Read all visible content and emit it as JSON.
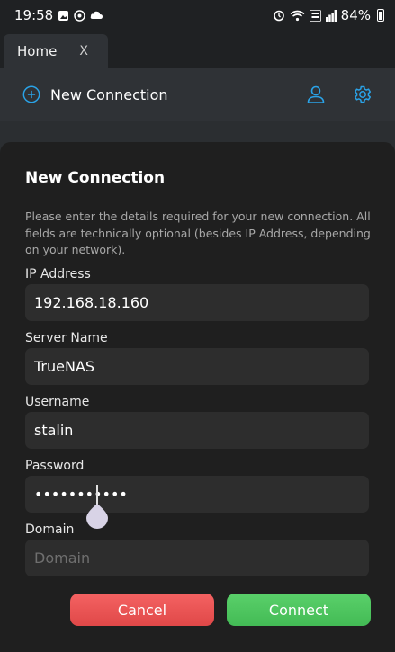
{
  "status_bar": {
    "time": "19:58",
    "battery": "84%"
  },
  "tab": {
    "label": "Home",
    "close": "X"
  },
  "toolbar": {
    "new_connection_label": "New Connection",
    "accent": "#2aa3e8"
  },
  "dialog": {
    "title": "New Connection",
    "description": "Please enter the details required for your new connection. All fields are technically optional (besides IP Address, depending on your network).",
    "fields": {
      "ip": {
        "label": "IP Address",
        "value": "192.168.18.160"
      },
      "server": {
        "label": "Server Name",
        "value": "TrueNAS"
      },
      "username": {
        "label": "Username",
        "value": "stalin"
      },
      "password": {
        "label": "Password",
        "value": "•••••••••••"
      },
      "domain": {
        "label": "Domain",
        "value": "",
        "placeholder": "Domain"
      }
    },
    "buttons": {
      "cancel": "Cancel",
      "connect": "Connect"
    }
  }
}
